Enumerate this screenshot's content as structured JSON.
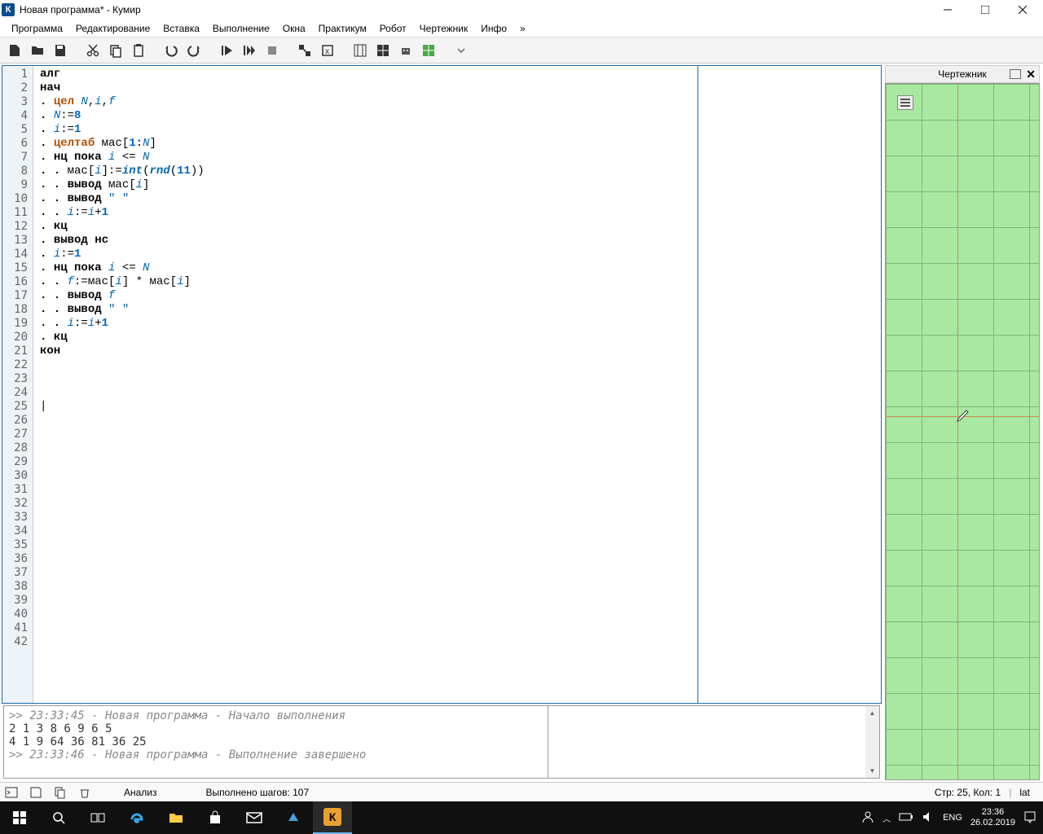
{
  "window": {
    "title": "Новая программа* - Кумир",
    "app_icon_letter": "К"
  },
  "menu": [
    "Программа",
    "Редактирование",
    "Вставка",
    "Выполнение",
    "Окна",
    "Практикум",
    "Робот",
    "Чертежник",
    "Инфо",
    "»"
  ],
  "gutter_lines": 42,
  "code_lines": [
    [
      [
        "kw",
        "алг"
      ]
    ],
    [
      [
        "kw",
        "нач"
      ]
    ],
    [
      [
        "dot",
        ". "
      ],
      [
        "ty",
        "цел"
      ],
      [
        "op",
        " "
      ],
      [
        "id",
        "N"
      ],
      [
        "op",
        ","
      ],
      [
        "id",
        "i"
      ],
      [
        "op",
        ","
      ],
      [
        "id",
        "f"
      ]
    ],
    [
      [
        "dot",
        ". "
      ],
      [
        "id",
        "N"
      ],
      [
        "op",
        ":="
      ],
      [
        "num",
        "8"
      ]
    ],
    [
      [
        "dot",
        ". "
      ],
      [
        "id",
        "i"
      ],
      [
        "op",
        ":="
      ],
      [
        "num",
        "1"
      ]
    ],
    [
      [
        "dot",
        ". "
      ],
      [
        "ty",
        "целтаб"
      ],
      [
        "op",
        " мас["
      ],
      [
        "num",
        "1"
      ],
      [
        "op",
        ":"
      ],
      [
        "id",
        "N"
      ],
      [
        "op",
        "]"
      ]
    ],
    [
      [
        "dot",
        ". "
      ],
      [
        "kw",
        "нц пока"
      ],
      [
        "op",
        " "
      ],
      [
        "id",
        "i"
      ],
      [
        "op",
        " <= "
      ],
      [
        "id",
        "N"
      ]
    ],
    [
      [
        "dot",
        ". . "
      ],
      [
        "op",
        "мас["
      ],
      [
        "id",
        "i"
      ],
      [
        "op",
        "]:="
      ],
      [
        "fn",
        "int"
      ],
      [
        "op",
        "("
      ],
      [
        "fn",
        "rnd"
      ],
      [
        "op",
        "("
      ],
      [
        "num",
        "11"
      ],
      [
        "op",
        "))"
      ]
    ],
    [
      [
        "dot",
        ". . "
      ],
      [
        "kw",
        "вывод"
      ],
      [
        "op",
        " мас["
      ],
      [
        "id",
        "i"
      ],
      [
        "op",
        "]"
      ]
    ],
    [
      [
        "dot",
        ". . "
      ],
      [
        "kw",
        "вывод"
      ],
      [
        "op",
        " "
      ],
      [
        "str",
        "\" \""
      ]
    ],
    [
      [
        "dot",
        ". . "
      ],
      [
        "id",
        "i"
      ],
      [
        "op",
        ":="
      ],
      [
        "id",
        "i"
      ],
      [
        "op",
        "+"
      ],
      [
        "num",
        "1"
      ]
    ],
    [
      [
        "dot",
        ". "
      ],
      [
        "kw",
        "кц"
      ]
    ],
    [
      [
        "dot",
        ". "
      ],
      [
        "kw",
        "вывод нс"
      ]
    ],
    [
      [
        "dot",
        ". "
      ],
      [
        "id",
        "i"
      ],
      [
        "op",
        ":="
      ],
      [
        "num",
        "1"
      ]
    ],
    [
      [
        "dot",
        ". "
      ],
      [
        "kw",
        "нц пока"
      ],
      [
        "op",
        " "
      ],
      [
        "id",
        "i"
      ],
      [
        "op",
        " <= "
      ],
      [
        "id",
        "N"
      ]
    ],
    [
      [
        "dot",
        ". . "
      ],
      [
        "id",
        "f"
      ],
      [
        "op",
        ":=мас["
      ],
      [
        "id",
        "i"
      ],
      [
        "op",
        "] * мас["
      ],
      [
        "id",
        "i"
      ],
      [
        "op",
        "]"
      ]
    ],
    [
      [
        "dot",
        ". . "
      ],
      [
        "kw",
        "вывод"
      ],
      [
        "op",
        " "
      ],
      [
        "id",
        "f"
      ]
    ],
    [
      [
        "dot",
        ". . "
      ],
      [
        "kw",
        "вывод"
      ],
      [
        "op",
        " "
      ],
      [
        "str",
        "\" \""
      ]
    ],
    [
      [
        "dot",
        ". . "
      ],
      [
        "id",
        "i"
      ],
      [
        "op",
        ":="
      ],
      [
        "id",
        "i"
      ],
      [
        "op",
        "+"
      ],
      [
        "num",
        "1"
      ]
    ],
    [
      [
        "dot",
        ". "
      ],
      [
        "kw",
        "кц"
      ]
    ],
    [
      [
        "kw",
        "кон"
      ]
    ]
  ],
  "output": {
    "log1": ">> 23:33:45 - Новая программа - Начало выполнения",
    "line1": "2 1 3 8 6 9 6 5 ",
    "line2": "4 1 9 64 36 81 36 25 ",
    "log2": ">> 23:33:46 - Новая программа - Выполнение завершено"
  },
  "draw_panel": {
    "title": "Чертежник"
  },
  "statusbar": {
    "mode": "Анализ",
    "steps": "Выполнено шагов: 107",
    "pos": "Стр: 25, Кол: 1",
    "lang_ind": "lat"
  },
  "taskbar": {
    "lang": "ENG",
    "time": "23:36",
    "date": "26.02.2019"
  }
}
